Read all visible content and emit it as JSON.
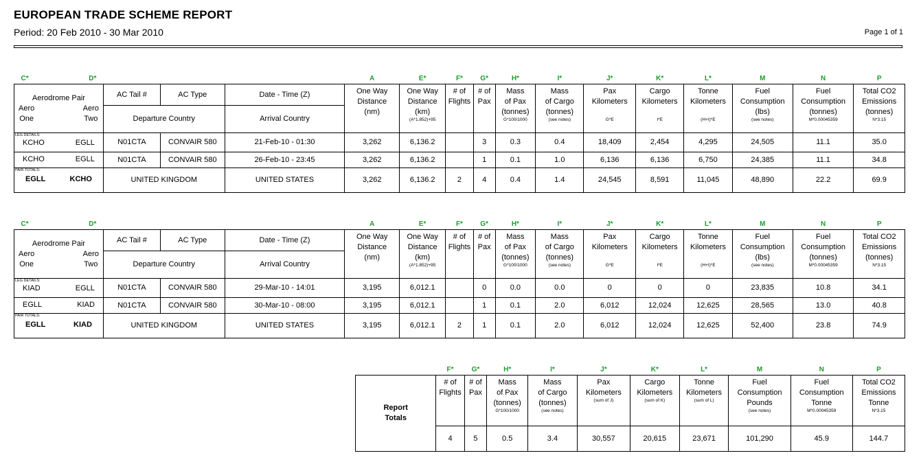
{
  "report": {
    "title": "EUROPEAN TRADE SCHEME REPORT",
    "period": "Period: 20 Feb 2010 - 30 Mar 2010",
    "page": "Page 1 of 1"
  },
  "colors": {
    "letter_green": "#1f9a2c"
  },
  "letters": {
    "C": "C*",
    "D": "D*",
    "A": "A",
    "E": "E*",
    "F": "F*",
    "G": "G*",
    "H": "H*",
    "I": "I*",
    "J": "J*",
    "K": "K*",
    "L": "L*",
    "M": "M",
    "N": "N",
    "P": "P"
  },
  "headers": {
    "aerodrome_pair": "Aerodrome Pair",
    "aero1": "Aero\nOne",
    "aero2": "Aero\nTwo",
    "ac_tail": "AC Tail #",
    "ac_type": "AC Type",
    "date_time": "Date - Time (Z)",
    "dep_country": "Departure Country",
    "arr_country": "Arrival Country",
    "one_way_nm": "One Way\nDistance\n(nm)",
    "one_way_km": "One Way\nDistance\n(km)",
    "one_way_km_formula": "(A*1.852)+95",
    "flights": "# of\nFlights",
    "pax": "# of\nPax",
    "mass_pax": "Mass\nof Pax\n(tonnes)",
    "mass_pax_formula": "G*100/1000",
    "mass_cargo": "Mass\nof Cargo\n(tonnes)",
    "mass_cargo_formula": "(see notes)",
    "pax_km": "Pax\nKilometers",
    "pax_km_formula": "G*E",
    "cargo_km": "Cargo\nKilometers",
    "cargo_km_formula": "I*E",
    "tonne_km": "Tonne\nKilometers",
    "tonne_km_formula": "(H+I)*E",
    "fuel_lbs": "Fuel\nConsumption\n(lbs)",
    "fuel_lbs_formula": "(see notes)",
    "fuel_t": "Fuel\nConsumption\n(tonnes)",
    "fuel_t_formula": "M*0.00045359",
    "co2": "Total CO2\nEmissions\n(tonnes)",
    "co2_formula": "N*3.15",
    "leg_details": "LEG DETAILS:",
    "pair_totals": "PAIR TOTALS:"
  },
  "sections": [
    {
      "legs": [
        {
          "a1": "KCHO",
          "a2": "EGLL",
          "tail": "N01CTA",
          "type": "CONVAIR 580",
          "dt": "21-Feb-10 - 01:30",
          "nm": "3,262",
          "km": "6,136.2",
          "flights": "",
          "pax": "3",
          "mpax": "0.3",
          "mcargo": "0.4",
          "paxkm": "18,409",
          "cargokm": "2,454",
          "tonkm": "4,295",
          "fuel_lbs": "24,505",
          "fuel_t": "11.1",
          "co2": "35.0"
        },
        {
          "a1": "KCHO",
          "a2": "EGLL",
          "tail": "N01CTA",
          "type": "CONVAIR 580",
          "dt": "26-Feb-10 - 23:45",
          "nm": "3,262",
          "km": "6,136.2",
          "flights": "",
          "pax": "1",
          "mpax": "0.1",
          "mcargo": "1.0",
          "paxkm": "6,136",
          "cargokm": "6,136",
          "tonkm": "6,750",
          "fuel_lbs": "24,385",
          "fuel_t": "11.1",
          "co2": "34.8"
        }
      ],
      "total": {
        "a1": "EGLL",
        "a2": "KCHO",
        "dep": "UNITED KINGDOM",
        "arr": "UNITED STATES",
        "nm": "3,262",
        "km": "6,136.2",
        "flights": "2",
        "pax": "4",
        "mpax": "0.4",
        "mcargo": "1.4",
        "paxkm": "24,545",
        "cargokm": "8,591",
        "tonkm": "11,045",
        "fuel_lbs": "48,890",
        "fuel_t": "22.2",
        "co2": "69.9"
      }
    },
    {
      "legs": [
        {
          "a1": "KIAD",
          "a2": "EGLL",
          "tail": "N01CTA",
          "type": "CONVAIR 580",
          "dt": "29-Mar-10 - 14:01",
          "nm": "3,195",
          "km": "6,012.1",
          "flights": "",
          "pax": "0",
          "mpax": "0.0",
          "mcargo": "0.0",
          "paxkm": "0",
          "cargokm": "0",
          "tonkm": "0",
          "fuel_lbs": "23,835",
          "fuel_t": "10.8",
          "co2": "34.1"
        },
        {
          "a1": "EGLL",
          "a2": "KIAD",
          "tail": "N01CTA",
          "type": "CONVAIR 580",
          "dt": "30-Mar-10 - 08:00",
          "nm": "3,195",
          "km": "6,012.1",
          "flights": "",
          "pax": "1",
          "mpax": "0.1",
          "mcargo": "2.0",
          "paxkm": "6,012",
          "cargokm": "12,024",
          "tonkm": "12,625",
          "fuel_lbs": "28,565",
          "fuel_t": "13.0",
          "co2": "40.8"
        }
      ],
      "total": {
        "a1": "EGLL",
        "a2": "KIAD",
        "dep": "UNITED KINGDOM",
        "arr": "UNITED STATES",
        "nm": "3,195",
        "km": "6,012.1",
        "flights": "2",
        "pax": "1",
        "mpax": "0.1",
        "mcargo": "2.0",
        "paxkm": "6,012",
        "cargokm": "12,024",
        "tonkm": "12,625",
        "fuel_lbs": "52,400",
        "fuel_t": "23.8",
        "co2": "74.9"
      }
    }
  ],
  "report_totals": {
    "label": "Report\nTotals",
    "headers": {
      "flights": "# of\nFlights",
      "pax": "# of\nPax",
      "mpax": "Mass\nof Pax\n(tonnes)",
      "mpax_f": "G*100/1000",
      "mcargo": "Mass\nof Cargo\n(tonnes)",
      "mcargo_f": "(see notes)",
      "paxkm": "Pax\nKilometers",
      "paxkm_f": "(sum of J)",
      "cargokm": "Cargo\nKilometers",
      "cargokm_f": "(sum of K)",
      "tonkm": "Tonne\nKilometers",
      "tonkm_f": "(sum of L)",
      "fuel_lbs": "Fuel\nConsumption\nPounds",
      "fuel_lbs_f": "(see notes)",
      "fuel_t": "Fuel\nConsumption\nTonne",
      "fuel_t_f": "M*0.00045359",
      "co2": "Total CO2\nEmissions\nTonne",
      "co2_f": "N*3.15"
    },
    "values": {
      "flights": "4",
      "pax": "5",
      "mpax": "0.5",
      "mcargo": "3.4",
      "paxkm": "30,557",
      "cargokm": "20,615",
      "tonkm": "23,671",
      "fuel_lbs": "101,290",
      "fuel_t": "45.9",
      "co2": "144.7"
    }
  }
}
